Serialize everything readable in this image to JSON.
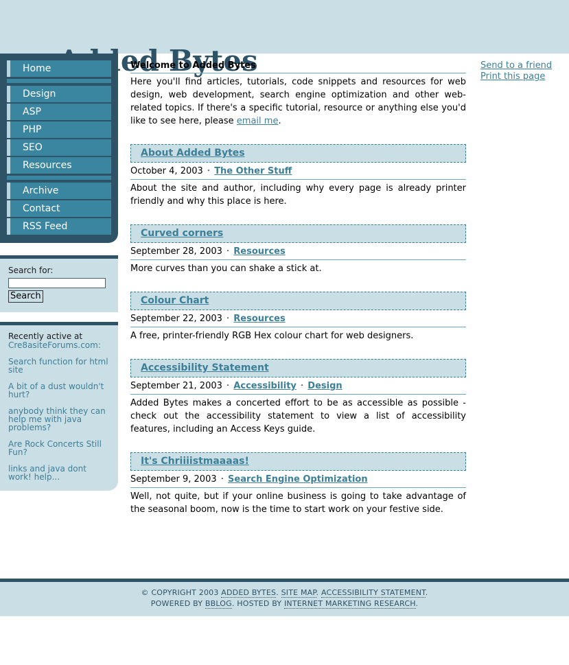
{
  "header": {
    "logo_part1": "Added",
    "logo_part2": "Bytes"
  },
  "nav": {
    "group1": [
      {
        "label": "Home"
      }
    ],
    "group2": [
      {
        "label": "Design"
      },
      {
        "label": "ASP"
      },
      {
        "label": "PHP"
      },
      {
        "label": "SEO"
      },
      {
        "label": "Resources"
      }
    ],
    "group3": [
      {
        "label": "Archive"
      },
      {
        "label": "Contact"
      },
      {
        "label": "RSS Feed"
      }
    ]
  },
  "search": {
    "label": "Search for:",
    "value": "",
    "placeholder": "",
    "button_label": "Search"
  },
  "recent": {
    "heading": "Recently active at",
    "forum_name": "Cre8asiteForums.com:",
    "items": [
      {
        "label": "Search function for html site"
      },
      {
        "label": "A bit of a dust wouldn't hurt?"
      },
      {
        "label": "anybody think they can help me with java problems?"
      },
      {
        "label": "Are Rock Concerts Still Fun?"
      },
      {
        "label": "links and java dont work! help..."
      }
    ]
  },
  "main": {
    "welcome_heading": "Welcome to Added Bytes",
    "welcome_text_before": "Here you'll find articles, tutorials, code snippets and resources for web design, web development, search engine optimization and other web-related topics. If there's a specific tutorial, resource or anything else you'd like to see here, please ",
    "welcome_link": "email me",
    "welcome_text_after": ".",
    "articles": [
      {
        "title": "About Added Bytes",
        "date": "October 4, 2003",
        "categories": [
          "The Other Stuff"
        ],
        "summary": "About the site and author, including why every page is already printer friendly and why this place is here."
      },
      {
        "title": "Curved corners",
        "date": "September 28, 2003",
        "categories": [
          "Resources"
        ],
        "summary": "More curves than you can shake a stick at."
      },
      {
        "title": "Colour Chart",
        "date": "September 22, 2003",
        "categories": [
          "Resources"
        ],
        "summary": "A free, printer-friendly RGB Hex colour chart for web designers."
      },
      {
        "title": "Accessibility Statement",
        "date": "September 21, 2003",
        "categories": [
          "Accessibility",
          "Design"
        ],
        "summary": "Added Bytes makes a concerted effort to be as accessible as possible - check out the accessibility statement to view a list of accessibility features, including an Access Keys guide."
      },
      {
        "title": "It's Chriiiistmaaaas!",
        "date": "September 9, 2003",
        "categories": [
          "Search Engine Optimization"
        ],
        "summary": "Well, not quite, but if your online business is going to take advantage of the seasonal boom, now is the time to start work on your festive side."
      }
    ]
  },
  "tools": {
    "send_to_friend": "Send to a friend",
    "print_page": "Print this page"
  },
  "footer": {
    "line1_prefix": "© COPYRIGHT 2003 ",
    "link_added_bytes": "ADDED BYTES",
    "sep1": ". ",
    "link_site_map": "SITE MAP",
    "sep2": ". ",
    "link_accessibility": "ACCESSIBILITY STATEMENT",
    "sep3": ".",
    "line2_prefix": "POWERED BY ",
    "link_bblog": "BBLOG",
    "sep4": ". HOSTED BY ",
    "link_imr": "INTERNET MARKETING RESEARCH",
    "sep5": "."
  },
  "colors": {
    "dark_teal": "#2e5266",
    "mid_teal": "#3a86a0",
    "link_teal": "#3c7f97",
    "light_blue": "#cadee5",
    "accent_bar": "#b9d6e0",
    "rule": "#6aa8be"
  }
}
